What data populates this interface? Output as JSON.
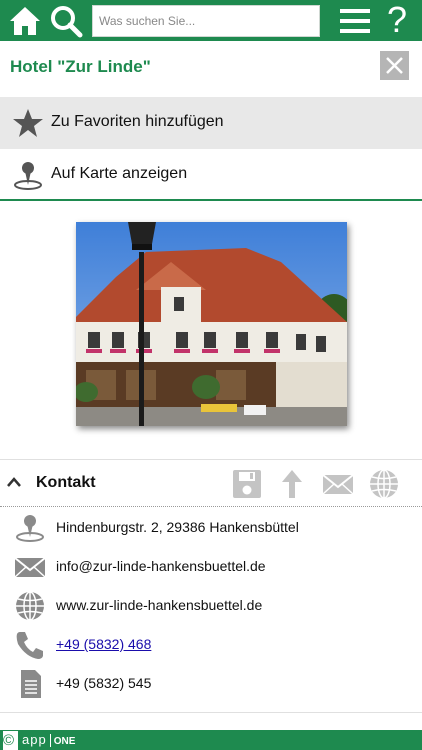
{
  "header": {
    "search_placeholder": "Was suchen Sie...",
    "help_label": "?",
    "accent_color": "#1e8a4f"
  },
  "page": {
    "title": "Hotel \"Zur Linde\""
  },
  "actions": {
    "favorite_label": "Zu Favoriten hinzufügen",
    "map_label": "Auf Karte anzeigen"
  },
  "contact": {
    "title": "Kontakt",
    "items": [
      {
        "icon": "location-pin-icon",
        "text": "Hindenburgstr. 2, 29386 Hankensbüttel"
      },
      {
        "icon": "envelope-icon",
        "text": "info@zur-linde-hankensbuettel.de"
      },
      {
        "icon": "globe-icon",
        "text": "www.zur-linde-hankensbuettel.de"
      },
      {
        "icon": "phone-icon",
        "text": "+49 (5832) 468"
      },
      {
        "icon": "fax-icon",
        "text": "+49 (5832) 545"
      }
    ]
  },
  "footer": {
    "copyright": "©",
    "brand_left": "app",
    "brand_right": "ONE"
  }
}
